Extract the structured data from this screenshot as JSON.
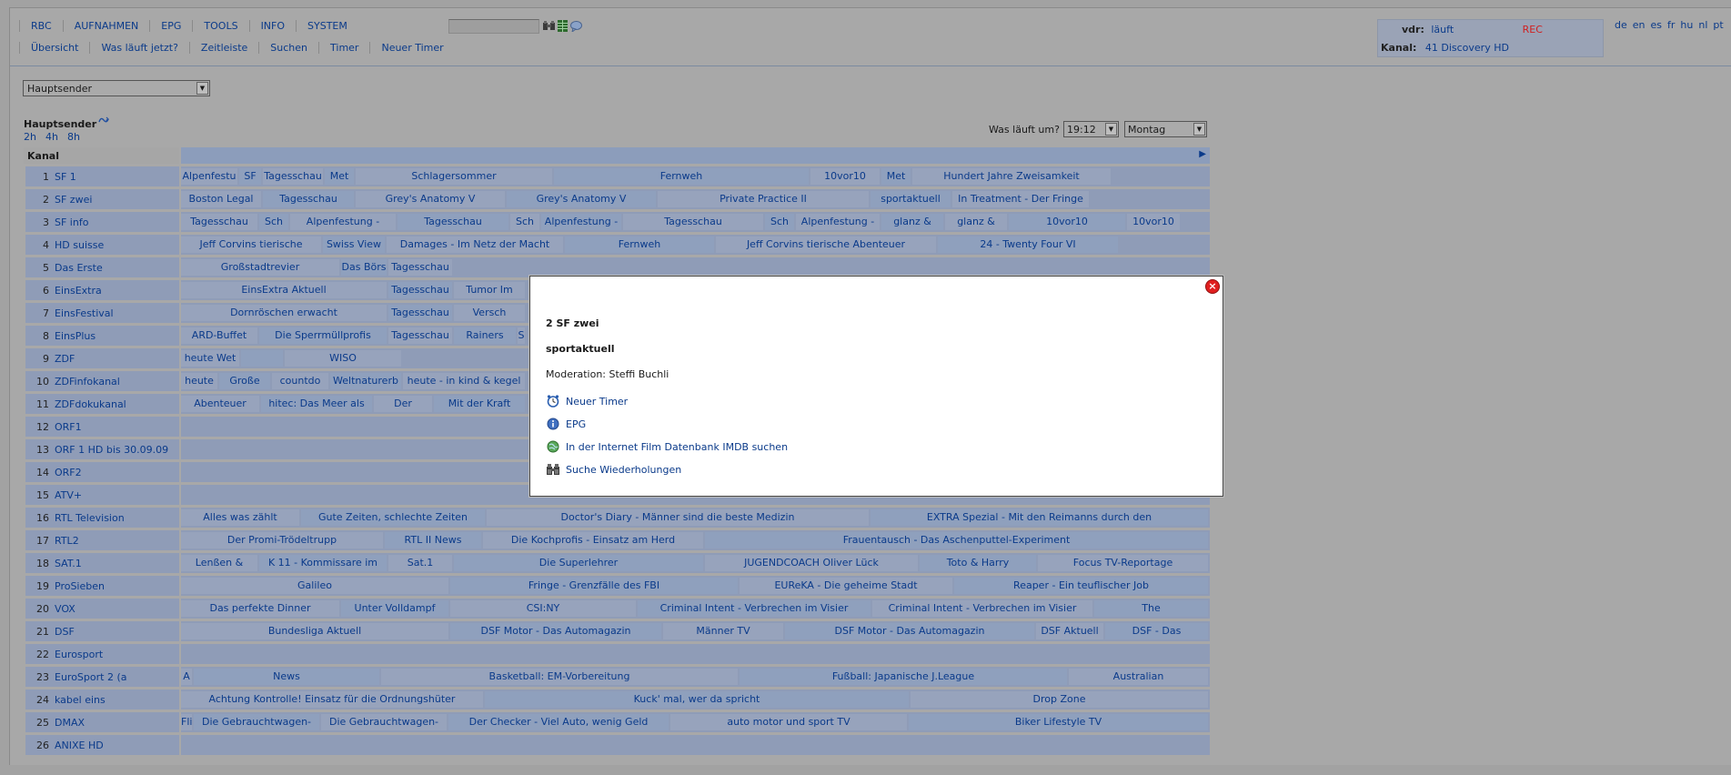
{
  "header": {
    "menu": [
      "RBC",
      "AUFNAHMEN",
      "EPG",
      "TOOLS",
      "INFO",
      "SYSTEM"
    ],
    "submenu": [
      "Übersicht",
      "Was läuft jetzt?",
      "Zeitleiste",
      "Suchen",
      "Timer",
      "Neuer Timer"
    ],
    "search": {
      "value": "",
      "placeholder": ""
    },
    "toolbar_icons": [
      "search-icon",
      "grid-icon",
      "chat-icon"
    ],
    "status": {
      "vdr_label": "vdr:",
      "vdr_value": "läuft",
      "rec_value": "REC",
      "rec_color": "#d02020",
      "kanal_label": "Kanal:",
      "kanal_value": "41 Discovery HD"
    },
    "languages": [
      "de",
      "en",
      "es",
      "fr",
      "hu",
      "nl",
      "pt"
    ]
  },
  "group_select": {
    "selected": "Hauptsender"
  },
  "grid": {
    "group_title": "Hauptsender",
    "hours": [
      "2h",
      "4h",
      "8h"
    ],
    "was_laeuft_label": "Was läuft um?",
    "time_selected": "19:12",
    "day_selected": "Montag",
    "kanal_header": "Kanal",
    "channels": [
      {
        "num": "1",
        "name": "SF 1",
        "events": [
          {
            "t": "Alpenfestu",
            "w": 64
          },
          {
            "t": "SF",
            "w": 26
          },
          {
            "t": "Tagesschau",
            "w": 68
          },
          {
            "t": "Met",
            "w": 34
          },
          {
            "t": "Schlagersommer",
            "w": 218
          },
          {
            "t": "Fernweh",
            "w": 282
          },
          {
            "t": "10vor10",
            "w": 78
          },
          {
            "t": "Met",
            "w": 34
          },
          {
            "t": "Hundert Jahre Zweisamkeit",
            "w": 220
          }
        ]
      },
      {
        "num": "2",
        "name": "SF zwei",
        "events": [
          {
            "t": "Boston Legal",
            "w": 90
          },
          {
            "t": "Tagesschau",
            "w": 102
          },
          {
            "t": "Grey's Anatomy V",
            "w": 166
          },
          {
            "t": "Grey's Anatomy V",
            "w": 166
          },
          {
            "t": "Private Practice II",
            "w": 234
          },
          {
            "t": "sportaktuell",
            "w": 90
          },
          {
            "t": "In Treatment - Der Fringe",
            "w": 152
          }
        ]
      },
      {
        "num": "3",
        "name": "SF info",
        "events": [
          {
            "t": "Tagesschau",
            "w": 86
          },
          {
            "t": "Sch",
            "w": 34
          },
          {
            "t": "Alpenfestung -",
            "w": 118
          },
          {
            "t": "Tagesschau",
            "w": 124
          },
          {
            "t": "Sch",
            "w": 34
          },
          {
            "t": "Alpenfestung -",
            "w": 90
          },
          {
            "t": "Tagesschau",
            "w": 156
          },
          {
            "t": "Sch",
            "w": 34
          },
          {
            "t": "Alpenfestung -",
            "w": 94
          },
          {
            "t": "glanz &",
            "w": 70
          },
          {
            "t": "glanz &",
            "w": 70
          },
          {
            "t": "10vor10",
            "w": 130
          },
          {
            "t": "10vor10",
            "w": 60
          }
        ]
      },
      {
        "num": "4",
        "name": "HD suisse",
        "events": [
          {
            "t": "Jeff Corvins tierische",
            "w": 156
          },
          {
            "t": "Swiss View",
            "w": 70
          },
          {
            "t": "Damages - Im Netz der Macht",
            "w": 196
          },
          {
            "t": "Fernweh",
            "w": 166
          },
          {
            "t": "Jeff Corvins tierische Abenteuer",
            "w": 244
          },
          {
            "t": "24 - Twenty Four VI",
            "w": 200
          }
        ]
      },
      {
        "num": "5",
        "name": "Das Erste",
        "events": [
          {
            "t": "Großstadtrevier",
            "w": 176
          },
          {
            "t": "Das Börs",
            "w": 52
          },
          {
            "t": "Tagesschau",
            "w": 72
          }
        ]
      },
      {
        "num": "6",
        "name": "EinsExtra",
        "events": [
          {
            "t": "EinsExtra Aktuell",
            "w": 228
          },
          {
            "t": "Tagesschau",
            "w": 72
          },
          {
            "t": "Tumor Im",
            "w": 80
          }
        ]
      },
      {
        "num": "7",
        "name": "EinsFestival",
        "events": [
          {
            "t": "Dornröschen erwacht",
            "w": 228
          },
          {
            "t": "Tagesschau",
            "w": 72
          },
          {
            "t": "Versch",
            "w": 80
          }
        ]
      },
      {
        "num": "8",
        "name": "EinsPlus",
        "events": [
          {
            "t": "ARD-Buffet",
            "w": 86
          },
          {
            "t": "Die Sperrmüllprofis",
            "w": 142
          },
          {
            "t": "Tagesschau",
            "w": 72
          },
          {
            "t": "Rainers",
            "w": 70
          },
          {
            "t": "S",
            "w": 10
          }
        ]
      },
      {
        "num": "9",
        "name": "ZDF",
        "events": [
          {
            "t": "heute Wet",
            "w": 66
          },
          {
            "t": "",
            "w": 48
          },
          {
            "t": "WISO",
            "w": 130
          }
        ]
      },
      {
        "num": "10",
        "name": "ZDFinfokanal",
        "events": [
          {
            "t": "heute",
            "w": 42
          },
          {
            "t": "Große",
            "w": 58
          },
          {
            "t": "countdo",
            "w": 64
          },
          {
            "t": "Weltnaturerb",
            "w": 80
          },
          {
            "t": "heute - in kind & kegel",
            "w": 136
          }
        ]
      },
      {
        "num": "11",
        "name": "ZDFdokukanal",
        "events": [
          {
            "t": "Abenteuer",
            "w": 88
          },
          {
            "t": "hitec: Das Meer als",
            "w": 124
          },
          {
            "t": "Der",
            "w": 66
          },
          {
            "t": "Mit der Kraft",
            "w": 102
          }
        ]
      },
      {
        "num": "12",
        "name": "ORF1",
        "events": []
      },
      {
        "num": "13",
        "name": "ORF 1 HD bis 30.09.09",
        "events": []
      },
      {
        "num": "14",
        "name": "ORF2",
        "events": []
      },
      {
        "num": "15",
        "name": "ATV+",
        "events": []
      },
      {
        "num": "16",
        "name": "RTL Television",
        "events": [
          {
            "t": "Alles was zählt",
            "w": 132
          },
          {
            "t": "Gute Zeiten, schlechte Zeiten",
            "w": 204
          },
          {
            "t": "Doctor's Diary - Männer sind die beste Medizin",
            "w": 422
          },
          {
            "t": "EXTRA Spezial - Mit den Reimanns durch den",
            "w": 373
          }
        ]
      },
      {
        "num": "17",
        "name": "RTL2",
        "events": [
          {
            "t": "Der Promi-Trödeltrupp",
            "w": 224
          },
          {
            "t": "RTL II News",
            "w": 108
          },
          {
            "t": "Die Kochprofis - Einsatz am Herd",
            "w": 244
          },
          {
            "t": "Frauentausch - Das Aschenputtel-Experiment",
            "w": 555
          }
        ]
      },
      {
        "num": "18",
        "name": "SAT.1",
        "events": [
          {
            "t": "Lenßen &",
            "w": 86
          },
          {
            "t": "K 11 - Kommissare im",
            "w": 142
          },
          {
            "t": "Sat.1",
            "w": 72
          },
          {
            "t": "Die Superlehrer",
            "w": 276
          },
          {
            "t": "JUGENDCOACH Oliver Lück",
            "w": 236
          },
          {
            "t": "Toto & Harry",
            "w": 130
          },
          {
            "t": "Focus TV-Reportage",
            "w": 189
          }
        ]
      },
      {
        "num": "19",
        "name": "ProSieben",
        "events": [
          {
            "t": "Galileo",
            "w": 296
          },
          {
            "t": "Fringe - Grenzfälle des FBI",
            "w": 318
          },
          {
            "t": "EUReKA - Die geheime Stadt",
            "w": 236
          },
          {
            "t": "Reaper - Ein teuflischer Job",
            "w": 281
          }
        ]
      },
      {
        "num": "20",
        "name": "VOX",
        "events": [
          {
            "t": "Das perfekte Dinner",
            "w": 176
          },
          {
            "t": "Unter Volldampf",
            "w": 120
          },
          {
            "t": "CSI:NY",
            "w": 206
          },
          {
            "t": "Criminal Intent - Verbrechen im Visier",
            "w": 258
          },
          {
            "t": "Criminal Intent - Verbrechen im Visier",
            "w": 244
          },
          {
            "t": "The",
            "w": 127
          }
        ]
      },
      {
        "num": "21",
        "name": "DSF",
        "events": [
          {
            "t": "Bundesliga Aktuell",
            "w": 296
          },
          {
            "t": "DSF Motor - Das Automagazin",
            "w": 234
          },
          {
            "t": "Männer TV",
            "w": 134
          },
          {
            "t": "DSF Motor - Das Automagazin",
            "w": 276
          },
          {
            "t": "DSF Aktuell",
            "w": 76
          },
          {
            "t": "DSF - Das",
            "w": 115
          }
        ]
      },
      {
        "num": "22",
        "name": "Eurosport",
        "events": []
      },
      {
        "num": "23",
        "name": "EuroSport 2 (a",
        "events": [
          {
            "t": "A",
            "w": 14
          },
          {
            "t": "News",
            "w": 206
          },
          {
            "t": "Basketball: EM-Vorbereitung",
            "w": 394
          },
          {
            "t": "Fußball: Japanische J.League",
            "w": 362
          },
          {
            "t": "Australian",
            "w": 155
          }
        ]
      },
      {
        "num": "24",
        "name": "kabel eins",
        "events": [
          {
            "t": "Achtung Kontrolle! Einsatz für die Ordnungshüter",
            "w": 334
          },
          {
            "t": "Kuck' mal, wer da spricht",
            "w": 468
          },
          {
            "t": "Drop Zone",
            "w": 329
          }
        ]
      },
      {
        "num": "25",
        "name": "DMAX",
        "events": [
          {
            "t": "Fli",
            "w": 14
          },
          {
            "t": "Die Gebrauchtwagen-",
            "w": 140
          },
          {
            "t": "Die Gebrauchtwagen-",
            "w": 140
          },
          {
            "t": "Der Checker - Viel Auto, wenig Geld",
            "w": 244
          },
          {
            "t": "auto motor und sport TV",
            "w": 262
          },
          {
            "t": "Biker Lifestyle TV",
            "w": 331
          }
        ]
      },
      {
        "num": "26",
        "name": "ANIXE HD",
        "events": []
      }
    ]
  },
  "popup": {
    "channel": "2 SF zwei",
    "title": "sportaktuell",
    "description": "Moderation: Steffi Buchli",
    "actions": [
      {
        "icon": "timer-icon",
        "label": "Neuer Timer"
      },
      {
        "icon": "info-icon",
        "label": "EPG"
      },
      {
        "icon": "globe-icon",
        "label": "In der Internet Film Datenbank IMDB suchen"
      },
      {
        "icon": "binoculars-icon",
        "label": "Suche Wiederholungen"
      }
    ]
  }
}
